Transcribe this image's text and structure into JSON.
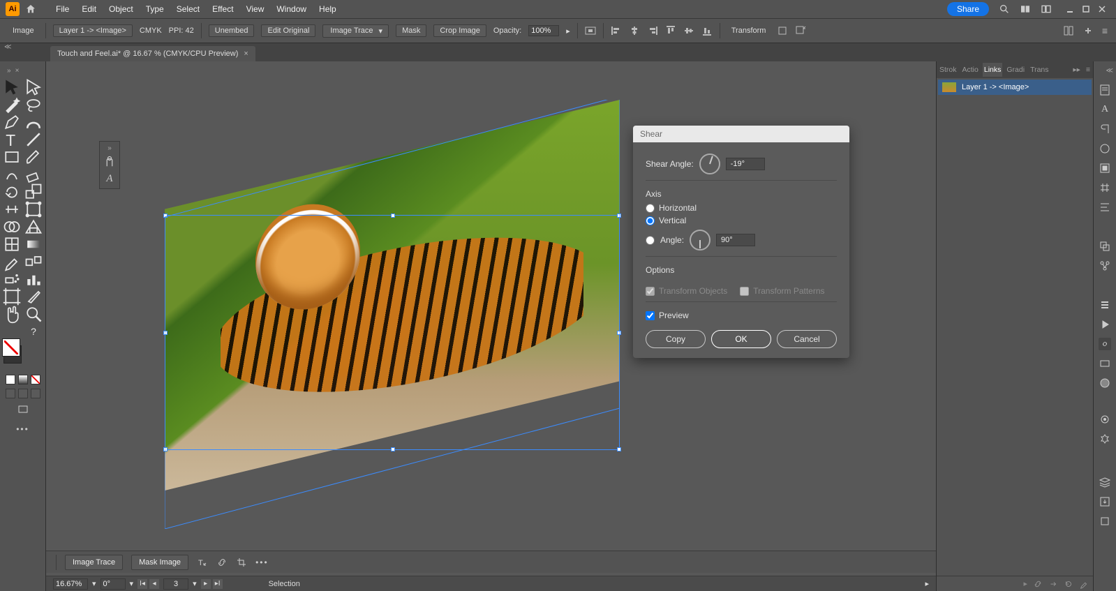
{
  "menu": {
    "items": [
      "File",
      "Edit",
      "Object",
      "Type",
      "Select",
      "Effect",
      "View",
      "Window",
      "Help"
    ],
    "share": "Share"
  },
  "control": {
    "context": "Image",
    "layer": "Layer 1 -> <Image>",
    "color_mode": "CMYK",
    "ppi_label": "PPI:",
    "ppi_value": "42",
    "unembed": "Unembed",
    "edit_original": "Edit Original",
    "image_trace": "Image Trace",
    "mask": "Mask",
    "crop": "Crop Image",
    "opacity_label": "Opacity:",
    "opacity_value": "100%",
    "transform": "Transform"
  },
  "tab": {
    "title": "Touch and Feel.ai* @ 16.67 % (CMYK/CPU Preview)"
  },
  "panels": {
    "tabs": [
      "Strok",
      "Actio",
      "Links",
      "Gradi",
      "Trans"
    ],
    "active": "Links",
    "link_item": "Layer 1 -> <Image>"
  },
  "footer": {
    "image_trace": "Image Trace",
    "mask_image": "Mask Image"
  },
  "status": {
    "zoom": "16.67%",
    "rotate": "0°",
    "artboard": "3",
    "mode": "Selection"
  },
  "dialog": {
    "title": "Shear",
    "shear_angle_label": "Shear Angle:",
    "shear_angle_value": "-19°",
    "axis_label": "Axis",
    "horizontal": "Horizontal",
    "vertical": "Vertical",
    "angle_label": "Angle:",
    "angle_value": "90°",
    "options_label": "Options",
    "transform_objects": "Transform Objects",
    "transform_patterns": "Transform Patterns",
    "preview": "Preview",
    "copy": "Copy",
    "ok": "OK",
    "cancel": "Cancel"
  }
}
